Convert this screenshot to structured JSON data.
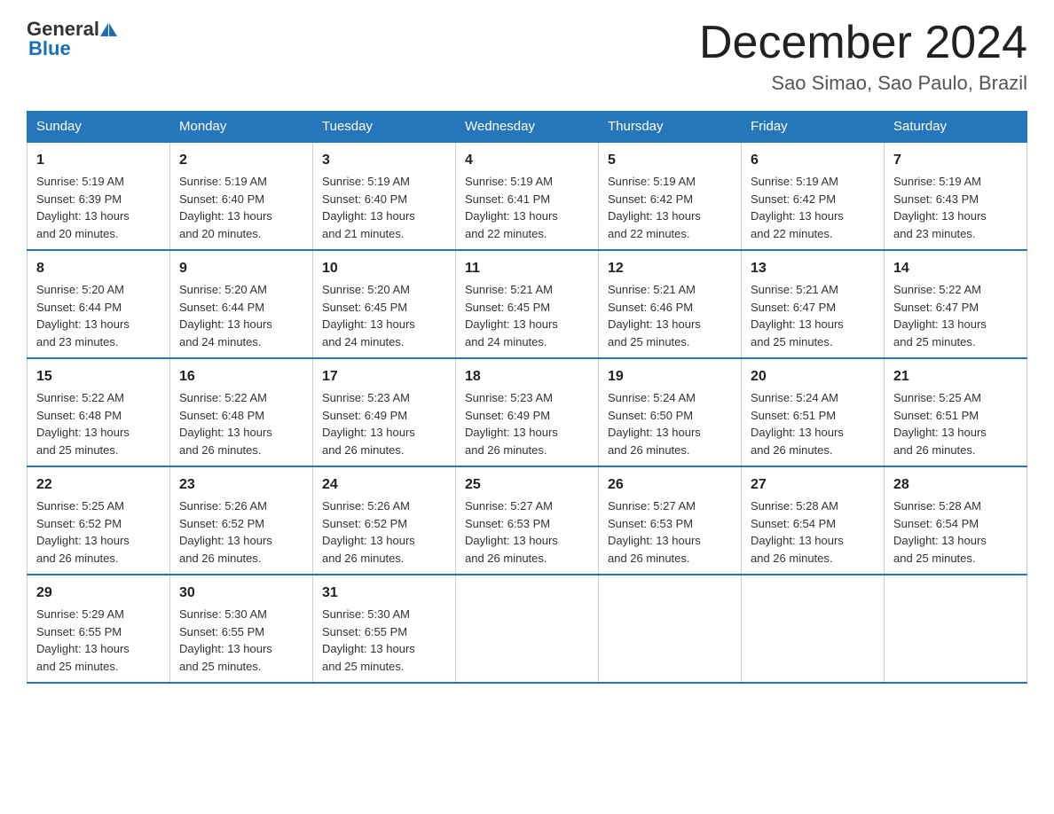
{
  "header": {
    "logo_general": "General",
    "logo_blue": "Blue",
    "month_title": "December 2024",
    "location": "Sao Simao, Sao Paulo, Brazil"
  },
  "days_of_week": [
    "Sunday",
    "Monday",
    "Tuesday",
    "Wednesday",
    "Thursday",
    "Friday",
    "Saturday"
  ],
  "weeks": [
    [
      {
        "day": "1",
        "sunrise": "5:19 AM",
        "sunset": "6:39 PM",
        "daylight": "13 hours and 20 minutes."
      },
      {
        "day": "2",
        "sunrise": "5:19 AM",
        "sunset": "6:40 PM",
        "daylight": "13 hours and 20 minutes."
      },
      {
        "day": "3",
        "sunrise": "5:19 AM",
        "sunset": "6:40 PM",
        "daylight": "13 hours and 21 minutes."
      },
      {
        "day": "4",
        "sunrise": "5:19 AM",
        "sunset": "6:41 PM",
        "daylight": "13 hours and 22 minutes."
      },
      {
        "day": "5",
        "sunrise": "5:19 AM",
        "sunset": "6:42 PM",
        "daylight": "13 hours and 22 minutes."
      },
      {
        "day": "6",
        "sunrise": "5:19 AM",
        "sunset": "6:42 PM",
        "daylight": "13 hours and 22 minutes."
      },
      {
        "day": "7",
        "sunrise": "5:19 AM",
        "sunset": "6:43 PM",
        "daylight": "13 hours and 23 minutes."
      }
    ],
    [
      {
        "day": "8",
        "sunrise": "5:20 AM",
        "sunset": "6:44 PM",
        "daylight": "13 hours and 23 minutes."
      },
      {
        "day": "9",
        "sunrise": "5:20 AM",
        "sunset": "6:44 PM",
        "daylight": "13 hours and 24 minutes."
      },
      {
        "day": "10",
        "sunrise": "5:20 AM",
        "sunset": "6:45 PM",
        "daylight": "13 hours and 24 minutes."
      },
      {
        "day": "11",
        "sunrise": "5:21 AM",
        "sunset": "6:45 PM",
        "daylight": "13 hours and 24 minutes."
      },
      {
        "day": "12",
        "sunrise": "5:21 AM",
        "sunset": "6:46 PM",
        "daylight": "13 hours and 25 minutes."
      },
      {
        "day": "13",
        "sunrise": "5:21 AM",
        "sunset": "6:47 PM",
        "daylight": "13 hours and 25 minutes."
      },
      {
        "day": "14",
        "sunrise": "5:22 AM",
        "sunset": "6:47 PM",
        "daylight": "13 hours and 25 minutes."
      }
    ],
    [
      {
        "day": "15",
        "sunrise": "5:22 AM",
        "sunset": "6:48 PM",
        "daylight": "13 hours and 25 minutes."
      },
      {
        "day": "16",
        "sunrise": "5:22 AM",
        "sunset": "6:48 PM",
        "daylight": "13 hours and 26 minutes."
      },
      {
        "day": "17",
        "sunrise": "5:23 AM",
        "sunset": "6:49 PM",
        "daylight": "13 hours and 26 minutes."
      },
      {
        "day": "18",
        "sunrise": "5:23 AM",
        "sunset": "6:49 PM",
        "daylight": "13 hours and 26 minutes."
      },
      {
        "day": "19",
        "sunrise": "5:24 AM",
        "sunset": "6:50 PM",
        "daylight": "13 hours and 26 minutes."
      },
      {
        "day": "20",
        "sunrise": "5:24 AM",
        "sunset": "6:51 PM",
        "daylight": "13 hours and 26 minutes."
      },
      {
        "day": "21",
        "sunrise": "5:25 AM",
        "sunset": "6:51 PM",
        "daylight": "13 hours and 26 minutes."
      }
    ],
    [
      {
        "day": "22",
        "sunrise": "5:25 AM",
        "sunset": "6:52 PM",
        "daylight": "13 hours and 26 minutes."
      },
      {
        "day": "23",
        "sunrise": "5:26 AM",
        "sunset": "6:52 PM",
        "daylight": "13 hours and 26 minutes."
      },
      {
        "day": "24",
        "sunrise": "5:26 AM",
        "sunset": "6:52 PM",
        "daylight": "13 hours and 26 minutes."
      },
      {
        "day": "25",
        "sunrise": "5:27 AM",
        "sunset": "6:53 PM",
        "daylight": "13 hours and 26 minutes."
      },
      {
        "day": "26",
        "sunrise": "5:27 AM",
        "sunset": "6:53 PM",
        "daylight": "13 hours and 26 minutes."
      },
      {
        "day": "27",
        "sunrise": "5:28 AM",
        "sunset": "6:54 PM",
        "daylight": "13 hours and 26 minutes."
      },
      {
        "day": "28",
        "sunrise": "5:28 AM",
        "sunset": "6:54 PM",
        "daylight": "13 hours and 25 minutes."
      }
    ],
    [
      {
        "day": "29",
        "sunrise": "5:29 AM",
        "sunset": "6:55 PM",
        "daylight": "13 hours and 25 minutes."
      },
      {
        "day": "30",
        "sunrise": "5:30 AM",
        "sunset": "6:55 PM",
        "daylight": "13 hours and 25 minutes."
      },
      {
        "day": "31",
        "sunrise": "5:30 AM",
        "sunset": "6:55 PM",
        "daylight": "13 hours and 25 minutes."
      },
      null,
      null,
      null,
      null
    ]
  ],
  "labels": {
    "sunrise": "Sunrise:",
    "sunset": "Sunset:",
    "daylight": "Daylight:"
  }
}
